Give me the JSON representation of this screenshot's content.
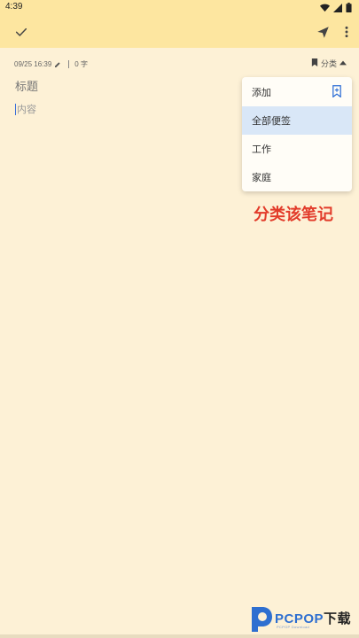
{
  "status_bar": {
    "time": "4:39"
  },
  "toolbar": {
    "icons": [
      "check-icon",
      "send-icon",
      "more-vert-icon"
    ]
  },
  "note": {
    "date_time": "09/25 16:39",
    "char_count": "0 字",
    "title_placeholder": "标题",
    "content_placeholder": "内容",
    "category_label": "分类"
  },
  "category_menu": {
    "items": [
      {
        "label": "添加",
        "icon": "bookmark-add-icon"
      },
      {
        "label": "全部便签",
        "selected": true
      },
      {
        "label": "工作"
      },
      {
        "label": "家庭"
      }
    ]
  },
  "annotation": {
    "text": "分类该笔记",
    "color": "#e23b2a"
  },
  "watermark": {
    "brand": "PCPOP",
    "suffix": "下载",
    "subtext": "PCPOP Download"
  },
  "colors": {
    "header": "#fde6a0",
    "background": "#fdf1d6",
    "selected_item": "#d9e7f7",
    "accent_blue": "#3b6fd8"
  }
}
